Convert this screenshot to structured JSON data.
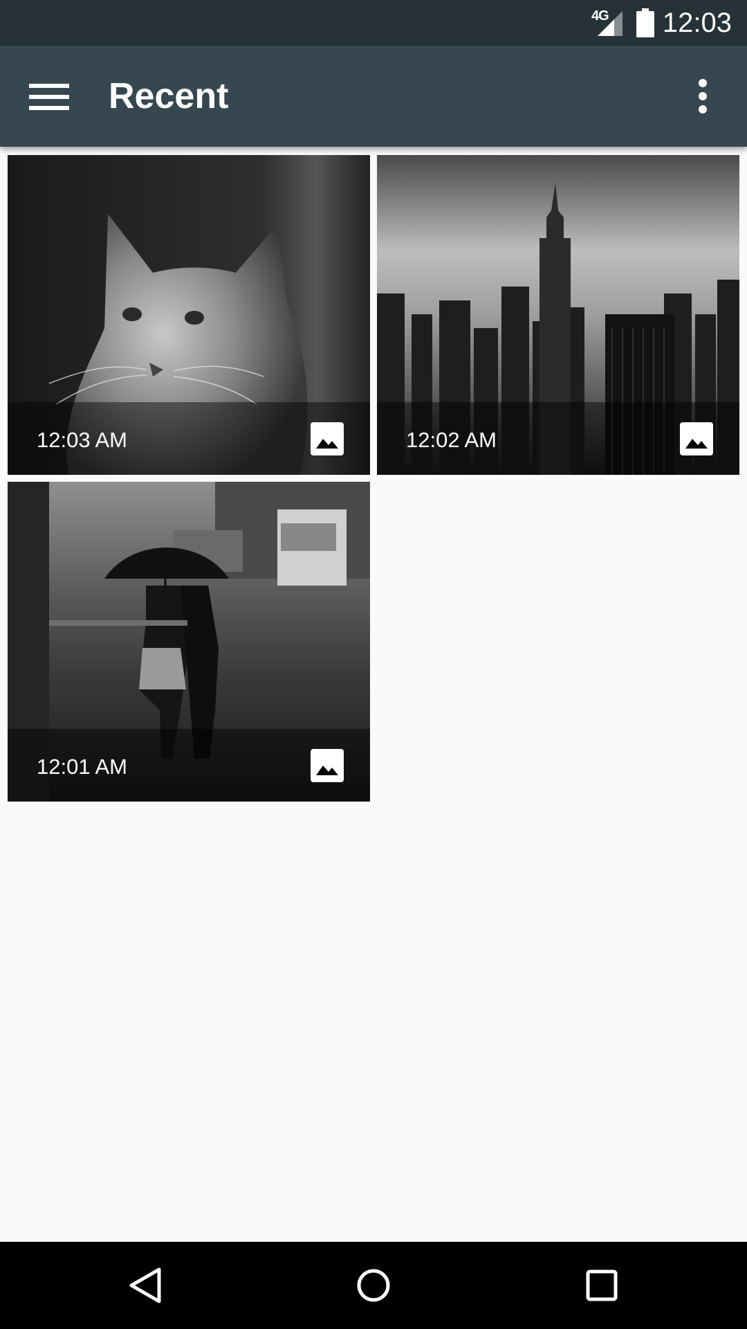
{
  "status_bar": {
    "network": "4G",
    "time": "12:03",
    "icons": [
      "signal-icon",
      "battery-icon"
    ]
  },
  "app_bar": {
    "title": "Recent",
    "menu_icon": "hamburger-menu-icon",
    "overflow_icon": "more-vert-icon"
  },
  "items": [
    {
      "time": "12:03 AM",
      "subject": "cat-photo",
      "type_icon": "image-icon"
    },
    {
      "time": "12:02 AM",
      "subject": "city-skyline-photo",
      "type_icon": "image-icon"
    },
    {
      "time": "12:01 AM",
      "subject": "rainy-street-photo",
      "type_icon": "image-icon"
    }
  ],
  "nav_bar": {
    "icons": [
      "back-icon",
      "home-icon",
      "recents-icon"
    ]
  },
  "colors": {
    "status_bar": "#263238",
    "app_bar": "#37474f",
    "background": "#fafafa",
    "nav_bar": "#000000"
  }
}
